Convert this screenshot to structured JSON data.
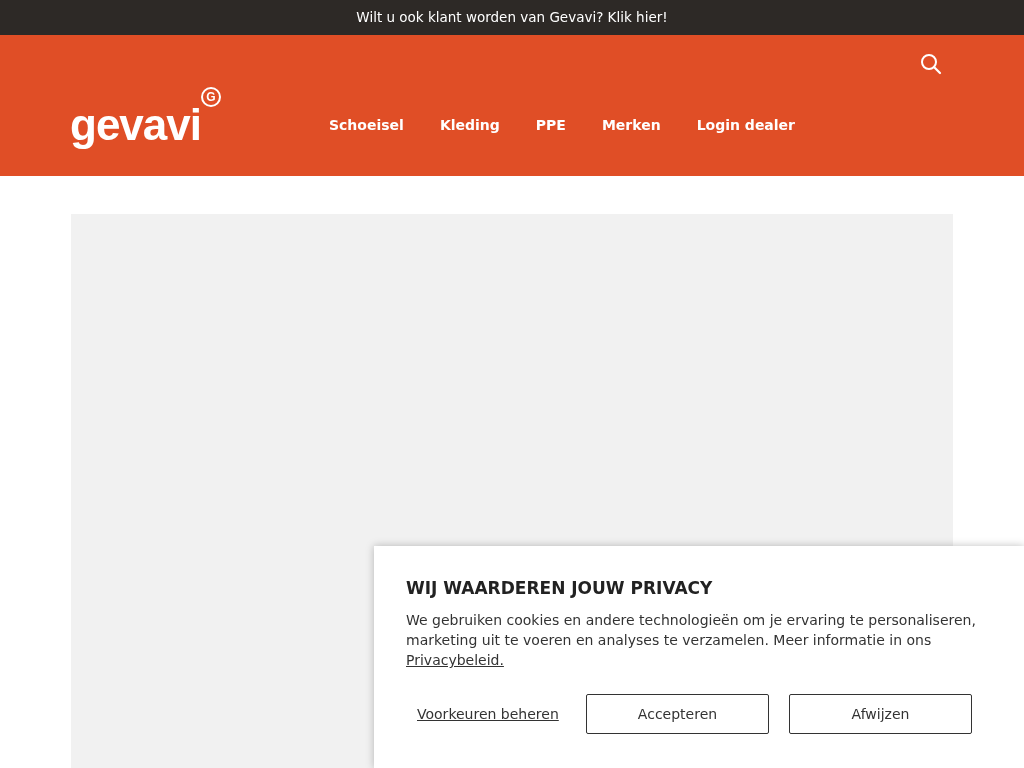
{
  "announcement": {
    "text": "Wilt u ook klant worden van Gevavi? Klik hier!"
  },
  "header": {
    "logo": {
      "text": "gevavi",
      "mark": "G"
    },
    "nav": [
      {
        "label": "Schoeisel"
      },
      {
        "label": "Kleding"
      },
      {
        "label": "PPE"
      },
      {
        "label": "Merken"
      },
      {
        "label": "Login dealer"
      }
    ]
  },
  "hero": {
    "kind": "placeholder"
  },
  "cookie_banner": {
    "title": "WIJ WAARDEREN JOUW PRIVACY",
    "text": "We gebruiken cookies en andere technologieën om je ervaring te personaliseren, marketing uit te voeren en analyses te verzamelen. Meer informatie in ons",
    "link": "Privacybeleid.",
    "preferences_link": "Voorkeuren beheren",
    "buttons": [
      {
        "label": "Accepteren"
      },
      {
        "label": "Afwijzen"
      }
    ]
  }
}
